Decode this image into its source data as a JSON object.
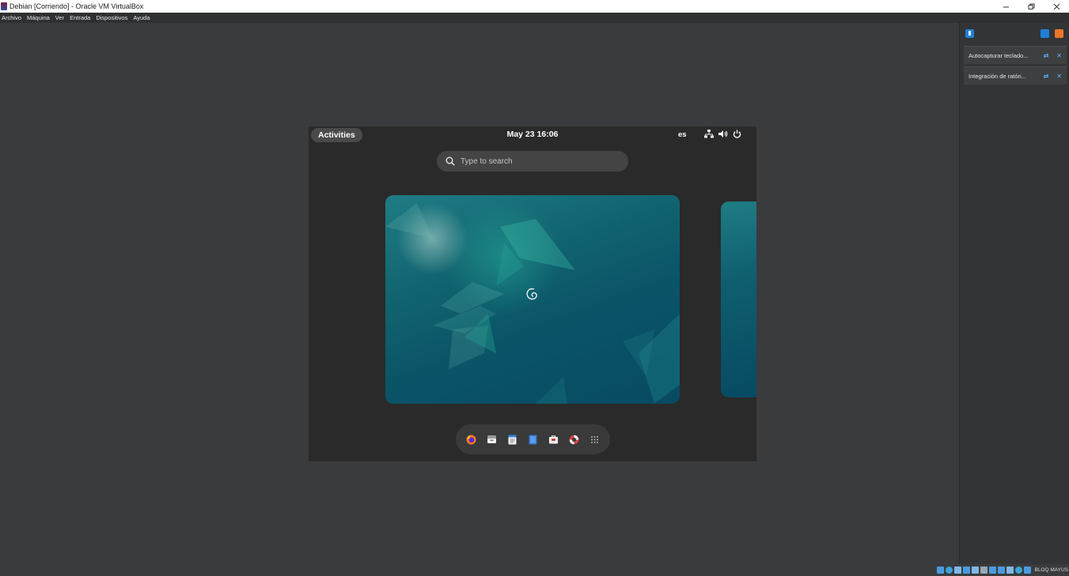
{
  "window": {
    "title": "Debian [Corriendo] - Oracle VM VirtualBox",
    "controls": [
      "minimize-icon",
      "restore-icon",
      "close-icon"
    ]
  },
  "menubar": {
    "items": [
      "Archivo",
      "Máquina",
      "Ver",
      "Entrada",
      "Dispositivos",
      "Ayuda"
    ]
  },
  "notifications": {
    "items": [
      {
        "text": "Autocapturar teclado..."
      },
      {
        "text": "Integración de ratón..."
      }
    ]
  },
  "statusbar": {
    "icons": [
      "hard-disk-icon",
      "optical-drive-icon",
      "audio-icon",
      "network-icon",
      "usb-icon",
      "shared-folders-icon",
      "display-icon",
      "video-capture-icon",
      "mouse-integration-icon",
      "keyboard-icon",
      "host-key-icon"
    ],
    "host_key_text": "BLOQ MAYUS"
  },
  "gnome": {
    "activities_label": "Activities",
    "clock": "May 23  16:06",
    "keyboard_layout": "es",
    "search_placeholder": "Type to search",
    "dash_apps": [
      "firefox-icon",
      "files-icon",
      "text-editor-icon",
      "libreoffice-writer-icon",
      "software-icon",
      "help-icon",
      "show-apps-icon"
    ]
  },
  "colors": {
    "host_background": "#3a3b3c",
    "guest_background": "#2a2a2a",
    "accent_blue": "#1e7fd8",
    "wallpaper_teal": "#0a5468"
  }
}
